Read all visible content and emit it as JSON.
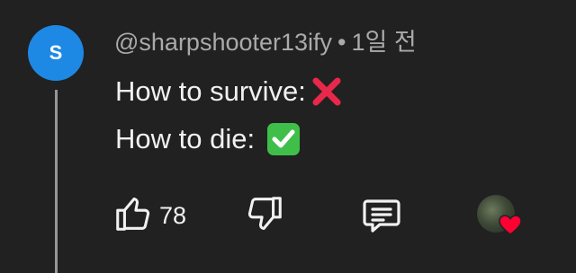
{
  "comment": {
    "avatar_letter": "S",
    "author": "@sharpshooter13ify",
    "separator": "•",
    "time": "1일 전",
    "lines": [
      {
        "text": "How to survive:",
        "emoji": "cross-mark-emoji"
      },
      {
        "text": "How to die: ",
        "emoji": "check-mark-button-emoji"
      }
    ]
  },
  "actions": {
    "like_count": "78",
    "like_icon": "thumbs-up-icon",
    "dislike_icon": "thumbs-down-icon",
    "reply_icon": "comment-icon",
    "hearted_icon": "creator-heart-icon"
  },
  "colors": {
    "background": "#212121",
    "avatar": "#1e88e5",
    "text_primary": "#f1f1f1",
    "text_secondary": "#aaaaaa",
    "cross": "#e8284a",
    "check_bg": "#3fbf4a",
    "heart": "#ff0033"
  }
}
